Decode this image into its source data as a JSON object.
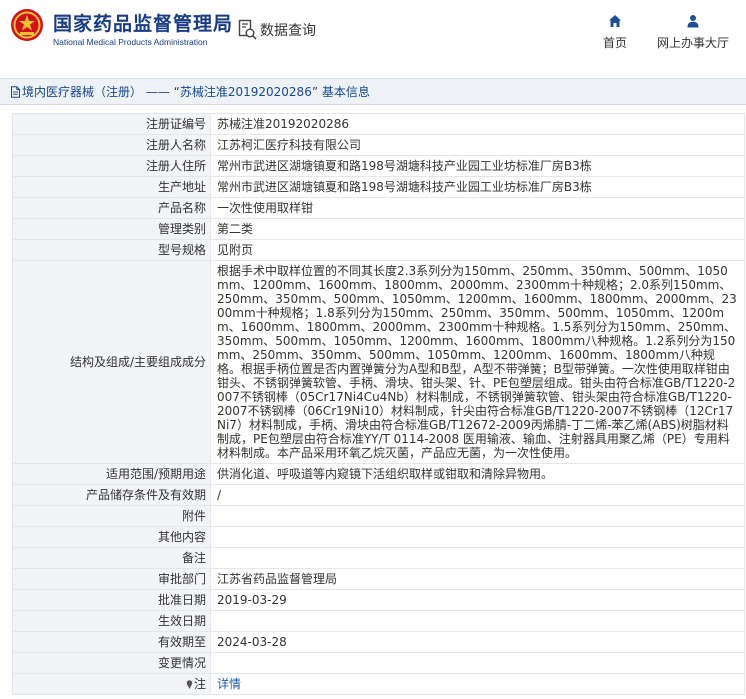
{
  "site": {
    "name_cn": "国家药品监督管理局",
    "name_en": "National Medical Products Administration",
    "query_label": "数据查询",
    "nav": [
      {
        "label": "首页",
        "icon": "home-icon"
      },
      {
        "label": "网上办事大厅",
        "icon": "user-icon"
      }
    ]
  },
  "breadcrumb": {
    "text": "境内医疗器械（注册） —— “苏械注准20192020286” 基本信息"
  },
  "rows": [
    {
      "key": "注册证编号",
      "value": "苏械注准20192020286"
    },
    {
      "key": "注册人名称",
      "value": "江苏柯汇医疗科技有限公司"
    },
    {
      "key": "注册人住所",
      "value": "常州市武进区湖塘镇夏和路198号湖塘科技产业园工业坊标准厂房B3栋"
    },
    {
      "key": "生产地址",
      "value": "常州市武进区湖塘镇夏和路198号湖塘科技产业园工业坊标准厂房B3栋"
    },
    {
      "key": "产品名称",
      "value": "一次性使用取样钳"
    },
    {
      "key": "管理类别",
      "value": "第二类"
    },
    {
      "key": "型号规格",
      "value": "见附页"
    },
    {
      "key": "结构及组成/主要组成成分",
      "value": "根据手术中取样位置的不同其长度2.3系列分为150mm、250mm、350mm、500mm、1050mm、1200mm、1600mm、1800mm、2000mm、2300mm十种规格；2.0系列150mm、250mm、350mm、500mm、1050mm、1200mm、1600mm、1800mm、2000mm、2300mm十种规格；1.8系列分为150mm、250mm、350mm、500mm、1050mm、1200mm、1600mm、1800mm、2000mm、2300mm十种规格。1.5系列分为150mm、250mm、350mm、500mm、1050mm、1200mm、1600mm、1800mm八种规格。1.2系列分为150mm、250mm、350mm、500mm、1050mm、1200mm、1600mm、1800mm八种规格。根据手柄位置是否内置弹簧分为A型和B型，A型不带弹簧；B型带弹簧。一次性使用取样钳由钳头、不锈钢弹簧软管、手柄、滑块、钳头架、针、PE包塑层组成。钳头由符合标准GB/T1220-2007不锈钢棒（05Cr17Ni4Cu4Nb）材料制成，不锈钢弹簧软管、钳头架由符合标准GB/T1220-2007不锈钢棒（06Cr19Ni10）材料制成，针尖由符合标准GB/T1220-2007不锈钢棒（12Cr17Ni7）材料制成，手柄、滑块由符合标准GB/T12672-2009丙烯腈-丁二烯-苯乙烯(ABS)树脂材料制成，PE包塑层由符合标准YY/T 0114-2008 医用输液、输血、注射器具用聚乙烯（PE）专用料材料制成。本产品采用环氧乙烷灭菌，产品应无菌，为一次性使用。"
    },
    {
      "key": "适用范围/预期用途",
      "value": "供消化道、呼吸道等内窥镜下活组织取样或钳取和清除异物用。"
    },
    {
      "key": "产品储存条件及有效期",
      "value": "/"
    },
    {
      "key": "附件",
      "value": ""
    },
    {
      "key": "其他内容",
      "value": ""
    },
    {
      "key": "备注",
      "value": ""
    },
    {
      "key": "审批部门",
      "value": "江苏省药品监督管理局"
    },
    {
      "key": "批准日期",
      "value": "2019-03-29"
    },
    {
      "key": "生效日期",
      "value": ""
    },
    {
      "key": "有效期至",
      "value": "2024-03-28"
    },
    {
      "key": "变更情况",
      "value": ""
    }
  ],
  "note_row": {
    "key": "注",
    "link_text": "详情"
  },
  "colors": {
    "brand_blue": "#173c83",
    "link_blue": "#1d5aa8",
    "key_bg": "#f2f4f7",
    "emblem_red": "#d0121b",
    "emblem_gold": "#f2c230"
  }
}
